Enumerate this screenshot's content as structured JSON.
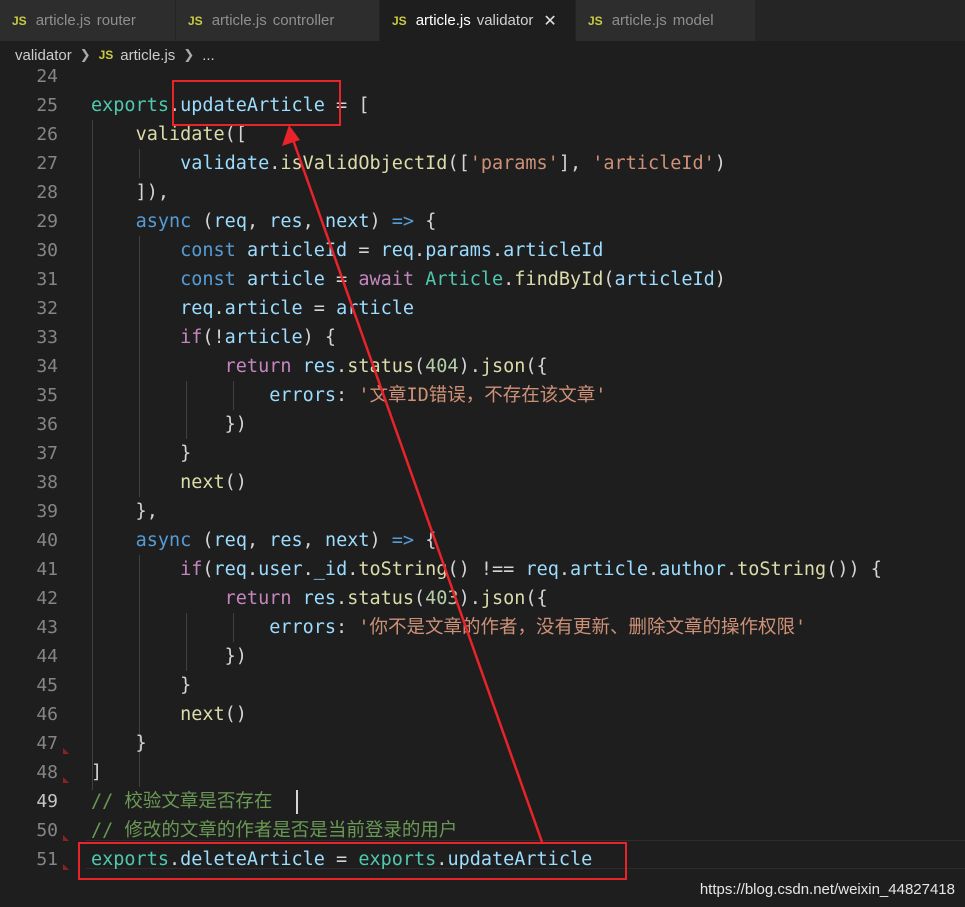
{
  "tabs": [
    {
      "label": "article.js",
      "desc": "router",
      "icon": "js-file-icon"
    },
    {
      "label": "article.js",
      "desc": "controller",
      "icon": "js-file-icon"
    },
    {
      "label": "article.js",
      "desc": "validator",
      "icon": "js-file-icon",
      "active": true
    },
    {
      "label": "article.js",
      "desc": "model",
      "icon": "js-file-icon"
    }
  ],
  "js_badge": "JS",
  "close_glyph": "✕",
  "breadcrumb": {
    "folder": "validator",
    "file": "article.js",
    "tail": "..."
  },
  "editor": {
    "current_line": 49,
    "lines": [
      24,
      25,
      26,
      27,
      28,
      29,
      30,
      31,
      32,
      33,
      34,
      35,
      36,
      37,
      38,
      39,
      40,
      41,
      42,
      43,
      44,
      45,
      46,
      47,
      48,
      49,
      50,
      51
    ]
  },
  "watermark": "https://blog.csdn.net/weixin_44827418",
  "colors": {
    "background": "#1e1e1e",
    "annotation_red": "#e8232a",
    "keyword": "#569cd6",
    "string": "#ce9178",
    "comment": "#6a9955"
  }
}
